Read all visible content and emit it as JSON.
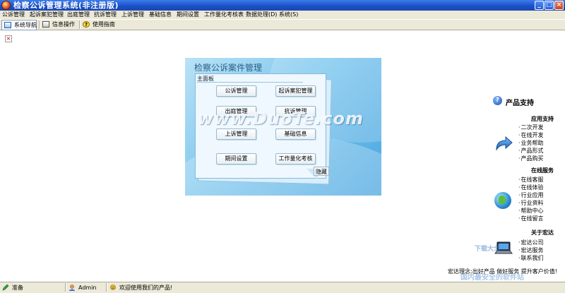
{
  "window": {
    "title": "检察公诉管理系统(非注册版)",
    "controls": {
      "minimize": "_",
      "maximize": "□",
      "close": "×"
    }
  },
  "menu": [
    "公诉管理",
    "起诉案犯管理",
    "出庭管理",
    "抗诉管理",
    "上诉管理",
    "基础信息",
    "期间设置",
    "工作量化考核表",
    "数据处理(D)",
    "系统(S)"
  ],
  "toolbar": {
    "nav_label": "系统导航",
    "info_label": "信息操作",
    "help_label": "使用指南",
    "help_glyph": "?"
  },
  "broken_image_glyph": "×",
  "panel": {
    "title": "检察公诉案件管理",
    "tab_label": "主面板",
    "buttons": {
      "gongsu": "公诉管理",
      "qisu": "起诉案犯管理",
      "chuting": "出庭管理",
      "kangsu": "抗诉管理",
      "shangsu": "上诉管理",
      "jichu": "基础信息",
      "qijian": "期间设置",
      "kaohe": "工作量化考核"
    },
    "hide_button": "隐藏",
    "watermark": "www.DuoTe.com"
  },
  "sidebar": {
    "heading": "产品支持",
    "help_glyph": "?",
    "app_support": {
      "title": "应用支持",
      "items": [
        "二次开发",
        "在线开发",
        "业务帮助",
        "产品形式",
        "产品购买"
      ]
    },
    "online_service": {
      "title": "在线服务",
      "items": [
        "在线客服",
        "在线体验",
        "行业应用",
        "行业资料",
        "帮助中心",
        "在线留言"
      ]
    },
    "about": {
      "title": "关于宏达",
      "items": [
        "宏达公司",
        "宏达服务",
        "联系我们"
      ]
    },
    "slogan": "宏达理念:出好产品 做好服务 提升客户价值!",
    "watermark_top": "下载大全",
    "watermark_bottom": "国内最安全的软件站"
  },
  "status": {
    "state": "准备",
    "user": "Admin",
    "message": "欢迎使用我们的产品!"
  }
}
